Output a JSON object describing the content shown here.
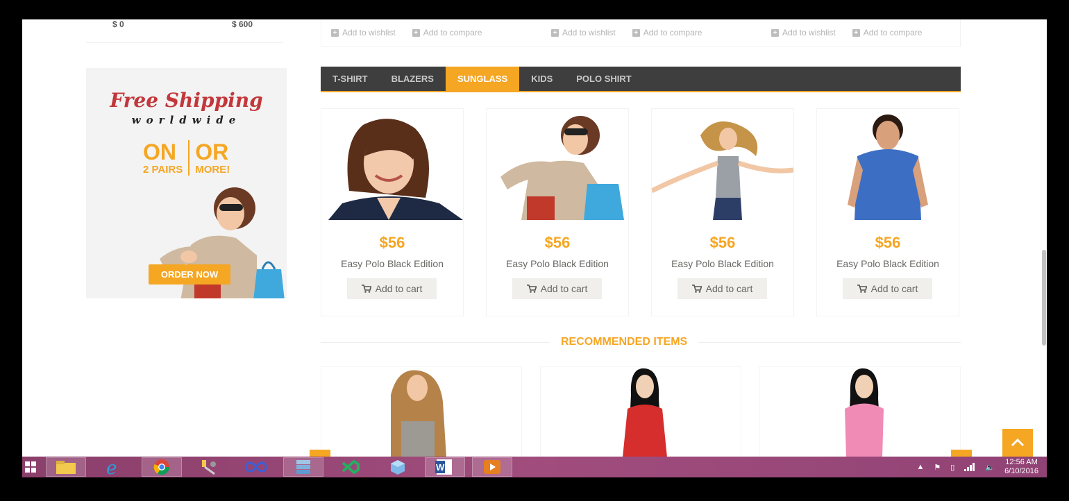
{
  "price_range": {
    "min": "$ 0",
    "max": "$ 600"
  },
  "top_actions": [
    {
      "wishlist": "Add to wishlist",
      "compare": "Add to compare"
    },
    {
      "wishlist": "Add to wishlist",
      "compare": "Add to compare"
    },
    {
      "wishlist": "Add to wishlist",
      "compare": "Add to compare"
    }
  ],
  "banner": {
    "title": "Free Shipping",
    "subtitle": "worldwide",
    "offer_left_big": "ON",
    "offer_left_small": "2 PAIRS",
    "offer_right_big": "OR",
    "offer_right_small": "MORE!",
    "cta": "ORDER NOW"
  },
  "tabs": [
    {
      "label": "T-SHIRT",
      "active": false
    },
    {
      "label": "BLAZERS",
      "active": false
    },
    {
      "label": "SUNGLASS",
      "active": true
    },
    {
      "label": "KIDS",
      "active": false
    },
    {
      "label": "POLO SHIRT",
      "active": false
    }
  ],
  "products": [
    {
      "price": "$56",
      "name": "Easy Polo Black Edition",
      "cart": "Add to cart",
      "image": "woman-portrait"
    },
    {
      "price": "$56",
      "name": "Easy Polo Black Edition",
      "cart": "Add to cart",
      "image": "woman-sunglasses-shopping"
    },
    {
      "price": "$56",
      "name": "Easy Polo Black Edition",
      "cart": "Add to cart",
      "image": "woman-jumping"
    },
    {
      "price": "$56",
      "name": "Easy Polo Black Edition",
      "cart": "Add to cart",
      "image": "man-blue-polo"
    }
  ],
  "recommended": {
    "title": "RECOMMENDED ITEMS",
    "items": [
      "girl-grey-top",
      "woman-red-dress",
      "woman-pink-dress"
    ]
  },
  "taskbar": {
    "apps": [
      "start-icon",
      "file-explorer-icon",
      "internet-explorer-icon",
      "chrome-icon",
      "tools-icon",
      "infinity-icon",
      "server-icon",
      "visual-studio-icon",
      "3d-box-icon",
      "word-icon",
      "media-player-icon"
    ],
    "time": "12:56 AM",
    "date": "6/10/2016"
  },
  "colors": {
    "accent": "#f5a623",
    "tabbar": "#3e3e3e",
    "banner_red": "#c2373b"
  }
}
